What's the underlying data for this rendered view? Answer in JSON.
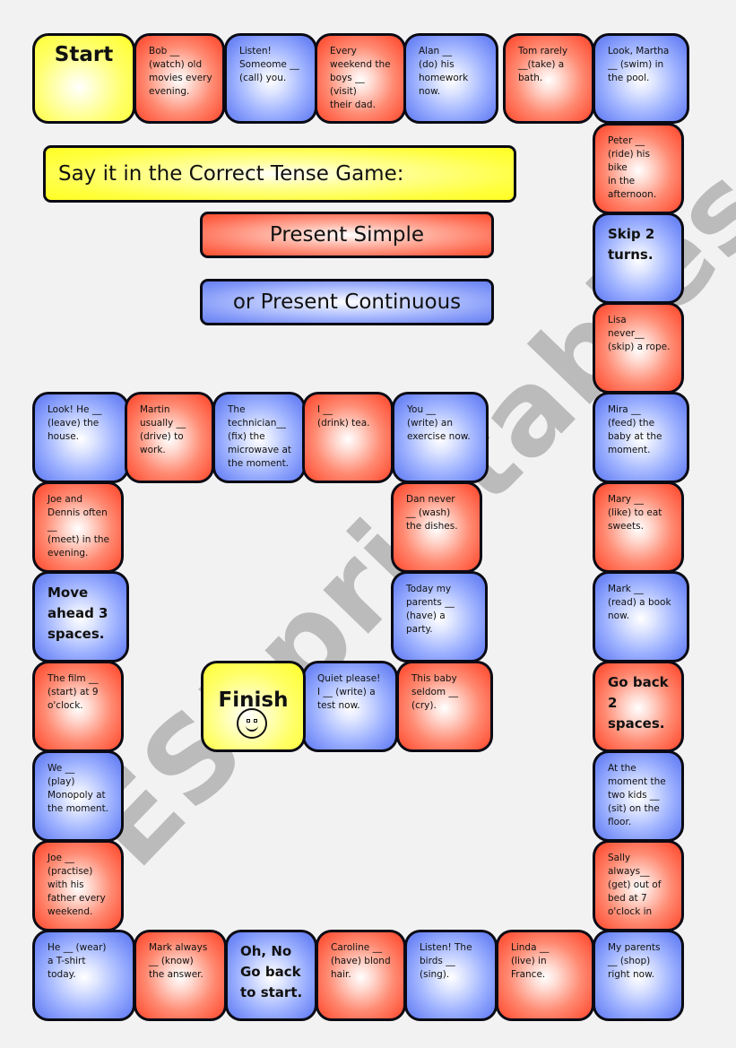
{
  "title": "Say it in the Correct Tense Game:",
  "subtitle_simple": "Present Simple",
  "subtitle_continuous": "or Present Continuous",
  "watermark": "ESLprintables.com",
  "colors": {
    "present_simple": "#ff5a3f",
    "present_continuous": "#6f88f6",
    "start_finish": "#ffff2a",
    "border": "#0a0a14",
    "background": "#f2f2f2"
  },
  "tiles": [
    {
      "id": 0,
      "type": "start",
      "color": "yellow",
      "text": "Start"
    },
    {
      "id": 1,
      "type": "sentence",
      "color": "red",
      "text": "Bob __\n(watch) old\nmovies every\nevening."
    },
    {
      "id": 2,
      "type": "sentence",
      "color": "blue",
      "text": "Listen!\nSomeome __\n(call) you."
    },
    {
      "id": 3,
      "type": "sentence",
      "color": "red",
      "text": "Every\nweekend the\nboys __\n(visit)\ntheir dad."
    },
    {
      "id": 4,
      "type": "sentence",
      "color": "blue",
      "text": "Alan __\n(do) his\nhomework\nnow."
    },
    {
      "id": 5,
      "type": "sentence",
      "color": "red",
      "text": "Tom rarely\n__(take) a\nbath."
    },
    {
      "id": 6,
      "type": "sentence",
      "color": "blue",
      "text": "Look, Martha\n__ (swim) in\nthe pool."
    },
    {
      "id": 7,
      "type": "sentence",
      "color": "red",
      "text": "Peter __\n(ride) his\nbike\nin the\nafternoon."
    },
    {
      "id": 8,
      "type": "action",
      "color": "blue",
      "text": "Skip 2\nturns."
    },
    {
      "id": 9,
      "type": "sentence",
      "color": "red",
      "text": "Lisa\nnever__\n(skip) a rope."
    },
    {
      "id": 10,
      "type": "sentence",
      "color": "blue",
      "text": "Mira __\n(feed) the\nbaby at the\nmoment."
    },
    {
      "id": 11,
      "type": "sentence",
      "color": "red",
      "text": "Mary __\n(like) to eat\nsweets."
    },
    {
      "id": 12,
      "type": "sentence",
      "color": "blue",
      "text": "Mark __\n(read) a book\nnow."
    },
    {
      "id": 13,
      "type": "action",
      "color": "red",
      "text": "Go back\n2\nspaces."
    },
    {
      "id": 14,
      "type": "sentence",
      "color": "blue",
      "text": "At the\nmoment the\ntwo kids __\n(sit) on the\nfloor."
    },
    {
      "id": 15,
      "type": "sentence",
      "color": "red",
      "text": "Sally\nalways__\n(get) out of\nbed at 7\no'clock in"
    },
    {
      "id": 16,
      "type": "sentence",
      "color": "blue",
      "text": "My parents\n__ (shop)\nright now."
    },
    {
      "id": 17,
      "type": "sentence",
      "color": "red",
      "text": "Linda __\n(live) in France."
    },
    {
      "id": 18,
      "type": "sentence",
      "color": "blue",
      "text": "Listen! The\nbirds __\n(sing)."
    },
    {
      "id": 19,
      "type": "sentence",
      "color": "red",
      "text": "Caroline __\n(have) blond\nhair."
    },
    {
      "id": 20,
      "type": "action",
      "color": "blue",
      "text": "Oh, No\nGo back\nto start."
    },
    {
      "id": 21,
      "type": "sentence",
      "color": "red",
      "text": "Mark always\n__ (know)\nthe answer."
    },
    {
      "id": 22,
      "type": "sentence",
      "color": "blue",
      "text": "He __ (wear)\na T-shirt\ntoday."
    },
    {
      "id": 23,
      "type": "sentence",
      "color": "red",
      "text": "Joe __\n(practise)\nwith        his\nfather every\nweekend."
    },
    {
      "id": 24,
      "type": "sentence",
      "color": "blue",
      "text": "We __\n(play)\nMonopoly at\nthe moment."
    },
    {
      "id": 25,
      "type": "sentence",
      "color": "red",
      "text": "The film __\n(start) at 9\no'clock."
    },
    {
      "id": 26,
      "type": "action",
      "color": "blue",
      "text": "Move\nahead 3\nspaces."
    },
    {
      "id": 27,
      "type": "sentence",
      "color": "red",
      "text": "Joe and\nDennis often\n__\n(meet) in the\nevening."
    },
    {
      "id": 28,
      "type": "sentence",
      "color": "blue",
      "text": "Look! He __\n(leave) the\nhouse."
    },
    {
      "id": 29,
      "type": "sentence",
      "color": "red",
      "text": "Martin\nusually __\n(drive) to\nwork."
    },
    {
      "id": 30,
      "type": "sentence",
      "color": "blue",
      "text": "The\ntechnician__\n(fix) the\nmicrowave at\nthe moment."
    },
    {
      "id": 31,
      "type": "sentence",
      "color": "red",
      "text": "I __\n(drink) tea."
    },
    {
      "id": 32,
      "type": "sentence",
      "color": "blue",
      "text": "You __\n(write) an\nexercise now."
    },
    {
      "id": 33,
      "type": "sentence",
      "color": "red",
      "text": "Dan never\n__ (wash)\nthe dishes."
    },
    {
      "id": 34,
      "type": "sentence",
      "color": "blue",
      "text": "Today my\nparents __\n(have) a\nparty."
    },
    {
      "id": 35,
      "type": "sentence",
      "color": "red",
      "text": "This baby\nseldom __\n(cry)."
    },
    {
      "id": 36,
      "type": "sentence",
      "color": "blue",
      "text": "Quiet please!\nI __ (write) a\ntest now."
    },
    {
      "id": 37,
      "type": "finish",
      "color": "yellow",
      "text": "Finish",
      "icon": "smiley-face-icon"
    }
  ]
}
